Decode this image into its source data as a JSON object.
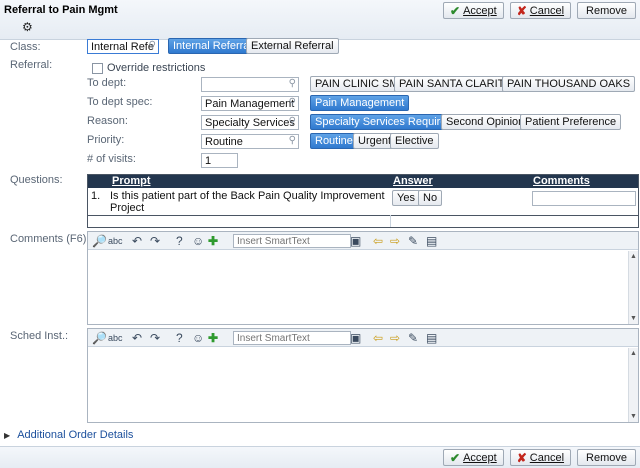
{
  "header": {
    "title": "Referral to Pain Mgmt",
    "accept": "Accept",
    "cancel": "Cancel",
    "remove": "Remove"
  },
  "class_row": {
    "label": "Class:",
    "value": "Internal Refe",
    "options": [
      "Internal Referral",
      "External Referral"
    ],
    "selected": "Internal Referral"
  },
  "referral": {
    "label": "Referral:",
    "override": "Override restrictions",
    "to_dept_label": "To dept:",
    "to_dept_value": "",
    "to_dept_options": [
      "PAIN CLINIC SM",
      "PAIN SANTA CLARITA",
      "PAIN THOUSAND OAKS"
    ],
    "to_dept_spec_label": "To dept spec:",
    "to_dept_spec_value": "Pain Management",
    "to_dept_spec_options": [
      "Pain Management"
    ],
    "reason_label": "Reason:",
    "reason_value": "Specialty Services",
    "reason_options": [
      "Specialty Services Required",
      "Second Opinion",
      "Patient Preference"
    ],
    "priority_label": "Priority:",
    "priority_value": "Routine",
    "priority_options": [
      "Routine",
      "Urgent",
      "Elective"
    ],
    "visits_label": "# of visits:",
    "visits_value": "1"
  },
  "questions": {
    "label": "Questions:",
    "col_prompt": "Prompt",
    "col_answer": "Answer",
    "col_comments": "Comments",
    "row_num": "1.",
    "row_prompt_line1": "Is this patient part of the Back Pain Quality Improvement",
    "row_prompt_line2": "Project",
    "yes": "Yes",
    "no": "No"
  },
  "comments": {
    "label": "Comments (F6):",
    "smarttext_placeholder": "Insert SmartText"
  },
  "sched": {
    "label": "Sched Inst.:",
    "smarttext_placeholder": "Insert SmartText"
  },
  "footer": {
    "additional": "Additional Order Details",
    "accept": "Accept",
    "cancel": "Cancel",
    "remove": "Remove"
  }
}
